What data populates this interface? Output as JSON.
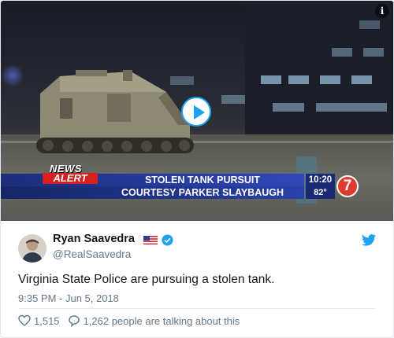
{
  "video": {
    "news_label": "NEWS",
    "alert_label": "ALERT",
    "headline_line1": "STOLEN TANK PURSUIT",
    "headline_line2": "COURTESY PARKER SLAYBAUGH",
    "time": "10:20",
    "temperature": "82°",
    "channel_number": "7",
    "info_icon": "info-icon",
    "play_icon": "play-icon"
  },
  "tweet": {
    "author_name": "Ryan Saavedra",
    "handle": "@RealSaavedra",
    "text": "Virginia State Police are pursuing a stolen tank.",
    "timestamp": "9:35 PM - Jun 5, 2018",
    "likes": "1,515",
    "replies_text": "1,262 people are talking about this",
    "icons": [
      "us-flag-icon",
      "verified-badge-icon",
      "twitter-bird-icon",
      "heart-icon",
      "reply-bubble-icon"
    ]
  },
  "colors": {
    "twitter_blue": "#1da1f2",
    "alert_red": "#d62020",
    "lower_third_blue": "#2941a9",
    "channel_logo_red": "#e03a2e"
  }
}
